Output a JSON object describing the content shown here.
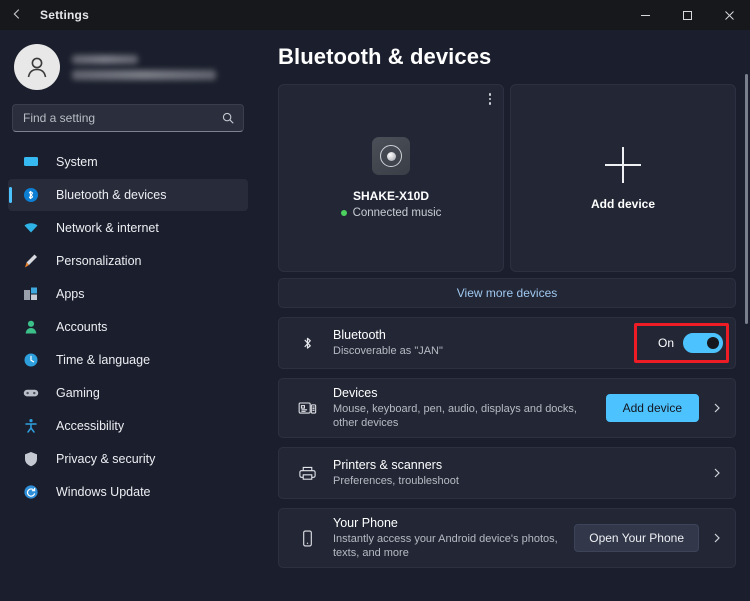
{
  "titlebar": {
    "back_icon": "arrow-left-icon",
    "title": "Settings",
    "minimize_label": "Minimize",
    "maximize_label": "Maximize",
    "close_label": "Close"
  },
  "sidebar": {
    "account": {
      "name_redacted": "",
      "email_redacted": ""
    },
    "search": {
      "value": "",
      "placeholder": "Find a setting",
      "icon": "search-icon"
    },
    "items": [
      {
        "label": "System",
        "icon": "monitor-icon",
        "active": false
      },
      {
        "label": "Bluetooth & devices",
        "icon": "bluetooth-icon",
        "active": true
      },
      {
        "label": "Network & internet",
        "icon": "wifi-icon",
        "active": false
      },
      {
        "label": "Personalization",
        "icon": "paintbrush-icon",
        "active": false
      },
      {
        "label": "Apps",
        "icon": "apps-icon",
        "active": false
      },
      {
        "label": "Accounts",
        "icon": "person-icon",
        "active": false
      },
      {
        "label": "Time & language",
        "icon": "clock-icon",
        "active": false
      },
      {
        "label": "Gaming",
        "icon": "gamepad-icon",
        "active": false
      },
      {
        "label": "Accessibility",
        "icon": "accessibility-icon",
        "active": false
      },
      {
        "label": "Privacy & security",
        "icon": "shield-icon",
        "active": false
      },
      {
        "label": "Windows Update",
        "icon": "refresh-icon",
        "active": false
      }
    ]
  },
  "main": {
    "page_title": "Bluetooth & devices",
    "device_card": {
      "name": "SHAKE-X10D",
      "status": "Connected music",
      "status_dot_color": "#4cd05e",
      "icon": "speaker-icon",
      "menu_icon": "more-options-icon"
    },
    "add_device_card": {
      "label": "Add device",
      "icon": "plus-icon"
    },
    "view_more_devices": "View more devices",
    "bluetooth_row": {
      "title": "Bluetooth",
      "subtitle": "Discoverable as \"JAN\"",
      "icon": "bluetooth-icon",
      "toggle_label": "On",
      "toggle_state": "on",
      "highlight_color": "#ee1c25",
      "accent_color": "#4cc2ff"
    },
    "devices_row": {
      "title": "Devices",
      "subtitle": "Mouse, keyboard, pen, audio, displays and docks, other devices",
      "icon": "devices-icon",
      "button_label": "Add device",
      "chevron": "chevron-right-icon"
    },
    "printers_row": {
      "title": "Printers & scanners",
      "subtitle": "Preferences, troubleshoot",
      "icon": "printer-icon",
      "chevron": "chevron-right-icon"
    },
    "your_phone_row": {
      "title": "Your Phone",
      "subtitle": "Instantly access your Android device's photos, texts, and more",
      "icon": "phone-icon",
      "button_label": "Open Your Phone",
      "chevron": "chevron-right-icon"
    }
  }
}
